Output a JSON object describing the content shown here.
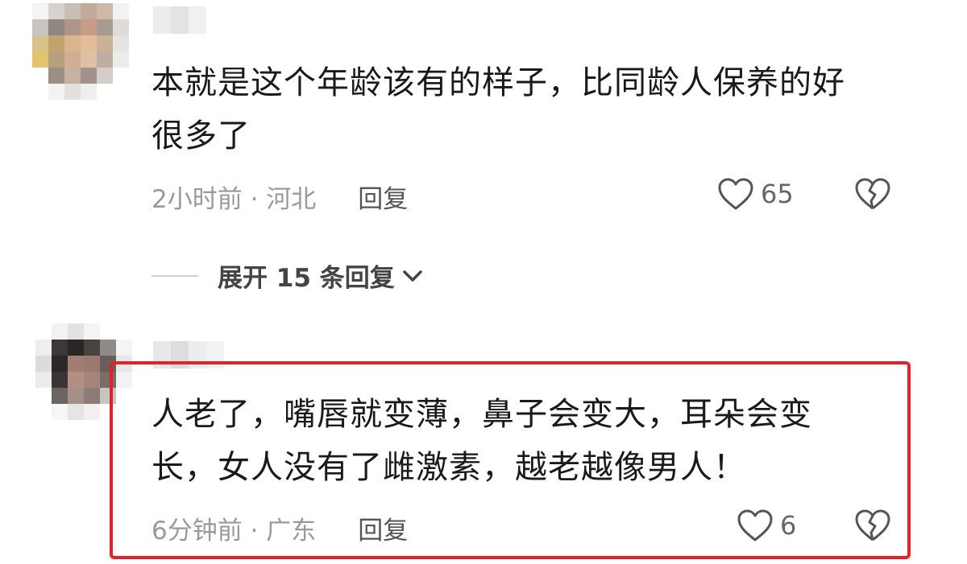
{
  "comments": [
    {
      "text_line1": "本就是这个年龄该有的样子，比同龄人保养的好",
      "text_line2": "很多了",
      "meta": "2小时前 · 河北",
      "reply_label": "回复",
      "likes": "65",
      "icons": {
        "like": "heart-icon",
        "dislike": "broken-heart-icon"
      }
    },
    {
      "text_line1": "人老了，嘴唇就变薄，鼻子会变大，耳朵会变",
      "text_line2": "长，女人没有了雌激素，越老越像男人！",
      "meta": "6分钟前 · 广东",
      "reply_label": "回复",
      "likes": "6",
      "icons": {
        "like": "heart-icon",
        "dislike": "broken-heart-icon"
      }
    }
  ],
  "expand_replies": {
    "label": "展开 15 条回复",
    "icon": "chevron-down-icon"
  },
  "colors": {
    "highlight": "#e0222c",
    "meta_text": "#9a9a9a",
    "body_text": "#1a1a1a"
  }
}
